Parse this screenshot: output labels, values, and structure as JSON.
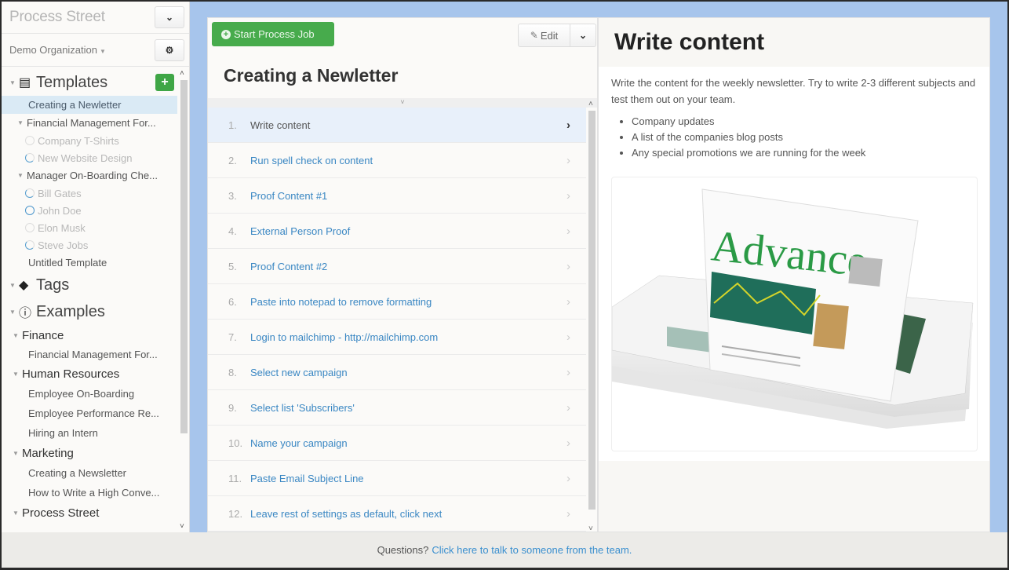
{
  "sidebar": {
    "app_title": "Process Street",
    "org_name": "Demo Organization",
    "sections": {
      "templates": "Templates",
      "tags": "Tags",
      "examples": "Examples"
    },
    "templates": {
      "items": [
        {
          "label": "Creating a Newletter"
        },
        {
          "label": "Financial Management For...",
          "jobs": [
            "Company T-Shirts",
            "New Website Design"
          ]
        },
        {
          "label": "Manager On-Boarding Che...",
          "jobs": [
            "Bill Gates",
            "John Doe",
            "Elon Musk",
            "Steve Jobs"
          ]
        },
        {
          "label": "Untitled Template"
        }
      ]
    },
    "examples": {
      "groups": [
        {
          "name": "Finance",
          "items": [
            "Financial Management For..."
          ]
        },
        {
          "name": "Human Resources",
          "items": [
            "Employee On-Boarding",
            "Employee Performance Re...",
            "Hiring an Intern"
          ]
        },
        {
          "name": "Marketing",
          "items": [
            "Creating a Newsletter",
            "How to Write a High Conve..."
          ]
        },
        {
          "name": "Process Street",
          "items": []
        }
      ]
    }
  },
  "toolbar": {
    "start_label": "Start Process Job",
    "edit_label": "Edit"
  },
  "checklist": {
    "title": "Creating a Newletter",
    "steps": [
      {
        "num": "1.",
        "label": "Write content"
      },
      {
        "num": "2.",
        "label": "Run spell check on content"
      },
      {
        "num": "3.",
        "label": "Proof Content #1"
      },
      {
        "num": "4.",
        "label": "External Person Proof"
      },
      {
        "num": "5.",
        "label": "Proof Content #2"
      },
      {
        "num": "6.",
        "label": "Paste into notepad to remove formatting"
      },
      {
        "num": "7.",
        "label": "Login to mailchimp - http://mailchimp.com"
      },
      {
        "num": "8.",
        "label": "Select new campaign"
      },
      {
        "num": "9.",
        "label": "Select list 'Subscribers'"
      },
      {
        "num": "10.",
        "label": "Name your campaign"
      },
      {
        "num": "11.",
        "label": "Paste Email Subject Line"
      },
      {
        "num": "12.",
        "label": "Leave rest of settings as default, click next"
      }
    ]
  },
  "detail": {
    "title": "Write content",
    "description": "Write the content for the weekly newsletter. Try to write 2-3 different subjects and test them out on your team.",
    "bullets": [
      "Company updates",
      "A list of the companies blog posts",
      "Any special promotions we are running for the week"
    ],
    "image_masthead": "Advance"
  },
  "footer": {
    "question": "Questions?",
    "link": "Click here to talk to someone from the team."
  },
  "colors": {
    "accent_green": "#47ab4c",
    "link_blue": "#3a87c3",
    "frame_blue": "#a7c5ec"
  }
}
